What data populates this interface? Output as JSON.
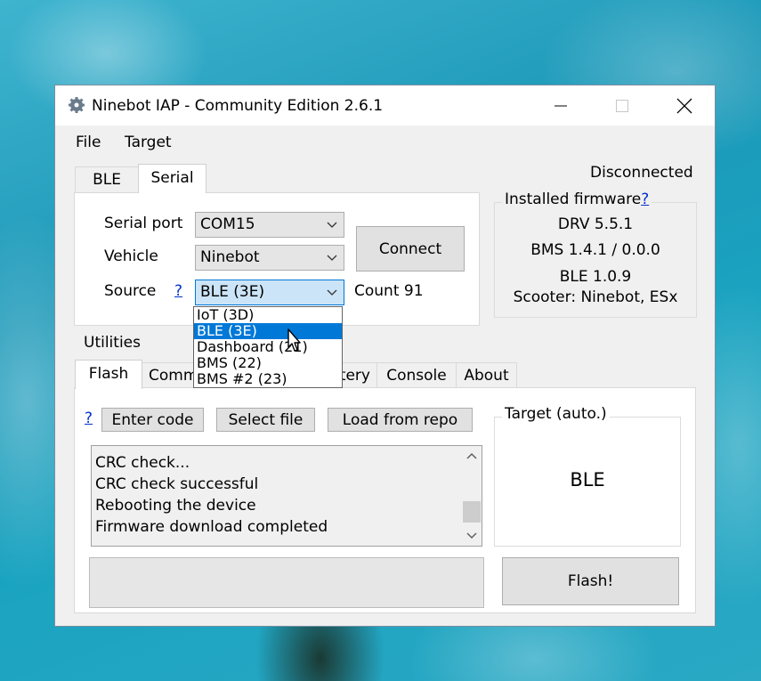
{
  "window": {
    "title": "Ninebot IAP - Community Edition 2.6.1",
    "controls": {
      "minimize": "—",
      "maximize": "☐",
      "close": "✕"
    }
  },
  "menu": {
    "items": [
      "File",
      "Target"
    ]
  },
  "connection": {
    "tabs": [
      "BLE",
      "Serial"
    ],
    "active_tab": "Serial",
    "status": "Disconnected",
    "serial_port_label": "Serial port",
    "serial_port_value": "COM15",
    "vehicle_label": "Vehicle",
    "vehicle_value": "Ninebot",
    "source_label": "Source",
    "source_help": "?",
    "source_value": "BLE (3E)",
    "count_text": "Count 91",
    "connect_label": "Connect"
  },
  "source_dropdown": {
    "options": [
      "IoT (3D)",
      "BLE (3E)",
      "Dashboard (21)",
      "BMS (22)",
      "BMS #2 (23)"
    ],
    "selected": "BLE (3E)"
  },
  "firmware": {
    "title": "Installed firmware",
    "help": "?",
    "lines": [
      "DRV 5.5.1",
      "BMS 1.4.1 / 0.0.0",
      "BLE 1.0.9",
      "Scooter: Ninebot, ESx"
    ]
  },
  "utilities": {
    "label": "Utilities",
    "tabs": [
      "Flash",
      "Comm",
      "tery",
      "Console",
      "About"
    ],
    "active_tab": "Flash"
  },
  "flash": {
    "help": "?",
    "enter_code": "Enter code",
    "select_file": "Select file",
    "load_from_repo": "Load from repo",
    "log": [
      "CRC check...",
      "CRC check successful",
      "Rebooting the device",
      "Firmware download completed"
    ],
    "target_title": "Target (auto.)",
    "target_value": "BLE",
    "flash_button": "Flash!"
  },
  "colors": {
    "selection": "#0078d7",
    "link": "#0033cc",
    "window_bg": "#f0f0f0"
  }
}
